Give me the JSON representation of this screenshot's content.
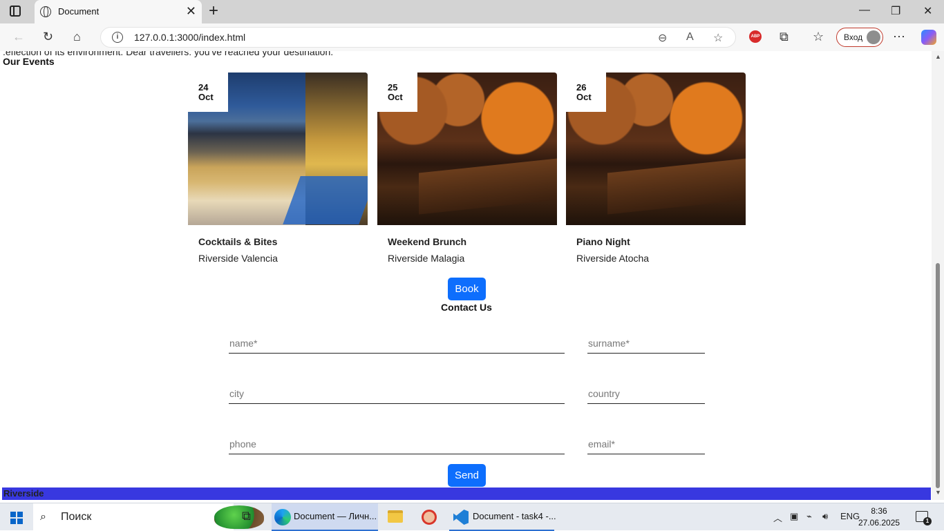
{
  "browser": {
    "tab_title": "Document",
    "tab_close": "✕",
    "new_tab": "+",
    "url": "127.0.0.1:3000/index.html",
    "login_label": "Вход",
    "adblock_label": "ABP",
    "window_controls": {
      "minimize": "—",
      "maximize": "❐",
      "close": "✕"
    },
    "nav_icons": {
      "back": "←",
      "reload": "↻",
      "home": "⌂",
      "zoom": "⊖",
      "read_aloud": "A",
      "favorite": "☆",
      "extensions": "⧉",
      "favorites": "☆",
      "more": "⋯"
    }
  },
  "page": {
    "clipped_text": ".eflection of its environment. Dear travellers: you've reached your destination.",
    "events_heading": "Our Events",
    "events": [
      {
        "day": "24",
        "month": "Oct",
        "title": "Cocktails & Bites",
        "location": "Riverside Valencia",
        "image": "terrace-photo"
      },
      {
        "day": "25",
        "month": "Oct",
        "title": "Weekend Brunch",
        "location": "Riverside Malagia",
        "image": "wine-cellar-photo"
      },
      {
        "day": "26",
        "month": "Oct",
        "title": "Piano Night",
        "location": "Riverside Atocha",
        "image": "wine-cellar-photo"
      }
    ],
    "book_label": "Book",
    "contact_heading": "Contact Us",
    "form": {
      "name": "name*",
      "surname": "surname*",
      "city": "city",
      "country": "country",
      "phone": "phone",
      "email": "email*"
    },
    "send_label": "Send",
    "footer_text": "Riverside",
    "colors": {
      "button": "#0d6efd",
      "footer": "#3838e0"
    }
  },
  "taskbar": {
    "search_placeholder": "Поиск",
    "edge_window": "Document — Личн...",
    "vscode_window": "Document - task4 -...",
    "language": "ENG",
    "time": "8:36",
    "date": "27.06.2025",
    "notifications": "1"
  }
}
